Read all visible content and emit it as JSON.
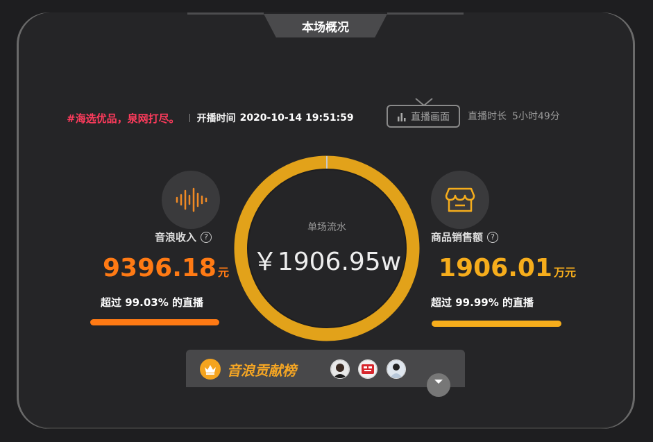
{
  "panel": {
    "title": "本场概况"
  },
  "info": {
    "hashtag": "#海选优品，泉网打尽。",
    "start_label": "开播时间",
    "start_time": "2020-10-14 19:51:59",
    "live_button": "直播画面",
    "duration_label": "直播时长",
    "duration_value": "5小时49分"
  },
  "left_stat": {
    "label": "音浪收入",
    "help": "?",
    "value": "9396.18",
    "unit": "元",
    "exceed_prefix": "超过",
    "exceed_pct": "99.03%",
    "exceed_suffix": "的直播",
    "color": "#ff7a14",
    "icon": "sound-wave-icon"
  },
  "center": {
    "label": "单场流水",
    "value": "￥1906.95w",
    "ring_color": "#e2a21a"
  },
  "right_stat": {
    "label": "商品销售额",
    "help": "?",
    "value": "1906.01",
    "unit": "万元",
    "exceed_prefix": "超过",
    "exceed_pct": "99.99%",
    "exceed_suffix": "的直播",
    "color": "#f6ad1c",
    "icon": "store-icon"
  },
  "ranking": {
    "title": "音浪贡献榜",
    "icon": "crown-icon",
    "expand_icon": "chevron-down-icon"
  }
}
